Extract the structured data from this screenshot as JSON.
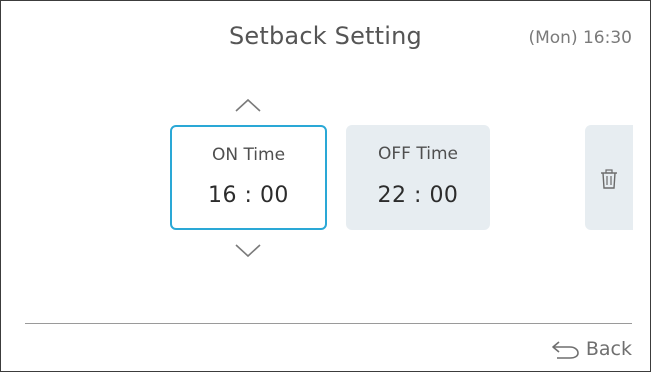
{
  "header": {
    "title": "Setback Setting",
    "clock": "(Mon) 16:30"
  },
  "on_time": {
    "label": "ON Time",
    "value": "16 : 00",
    "selected": true
  },
  "off_time": {
    "label": "OFF Time",
    "value": "22 : 00",
    "selected": false
  },
  "controls": {
    "increase_icon": "chevron-up-icon",
    "decrease_icon": "chevron-down-icon",
    "delete_icon": "trash-icon"
  },
  "footer": {
    "back_label": "Back",
    "back_icon": "return-arrow-icon"
  },
  "colors": {
    "selected_border": "#2aa8d6",
    "card_background": "#e7edf1",
    "text": "#3a3a3a"
  }
}
